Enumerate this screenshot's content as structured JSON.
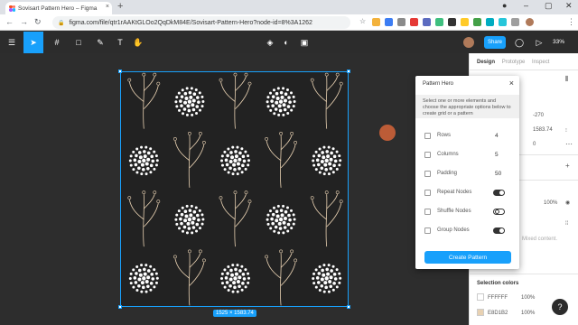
{
  "browser": {
    "tab_title": "Sovisart Pattern Hero – Figma",
    "tab_close": "×",
    "new_tab": "+",
    "url": "figma.com/file/qtr1rAAKtGLOo2QqDkM84E/Sovisart-Pattern-Hero?node-id=8%3A1262"
  },
  "figma": {
    "share_label": "Share",
    "zoom_label": "33%",
    "selection_dims": "1525 × 1583.74"
  },
  "right_panel": {
    "tabs": [
      "Design",
      "Prototype",
      "Inspect"
    ],
    "y_value": "-270",
    "h_value": "1583.74",
    "rotation_value": "0",
    "opacity_label": "100%",
    "mixed_content": "Mixed content.",
    "selection_colors_title": "Selection colors",
    "colors": [
      {
        "hex": "FFFFFF",
        "opacity": "100%",
        "swatch": "#ffffff"
      },
      {
        "hex": "E8D1B2",
        "opacity": "100%",
        "swatch": "#e8d1b2"
      }
    ],
    "help": "?"
  },
  "plugin": {
    "title": "Pattern Hero",
    "close": "×",
    "description": "Select one or more elements and choose the appropriate options below to create grid or a pattern",
    "rows_label": "Rows",
    "rows_value": "4",
    "columns_label": "Columns",
    "columns_value": "5",
    "padding_label": "Padding",
    "padding_value": "50",
    "repeat_label": "Repeat Nodes",
    "repeat_on": true,
    "shuffle_label": "Shuffle Nodes",
    "shuffle_on": false,
    "group_label": "Group Nodes",
    "group_on": true,
    "create_label": "Create Pattern"
  },
  "colors": {
    "accent": "#18a0fb",
    "pattern_line": "#e8d1b2"
  }
}
